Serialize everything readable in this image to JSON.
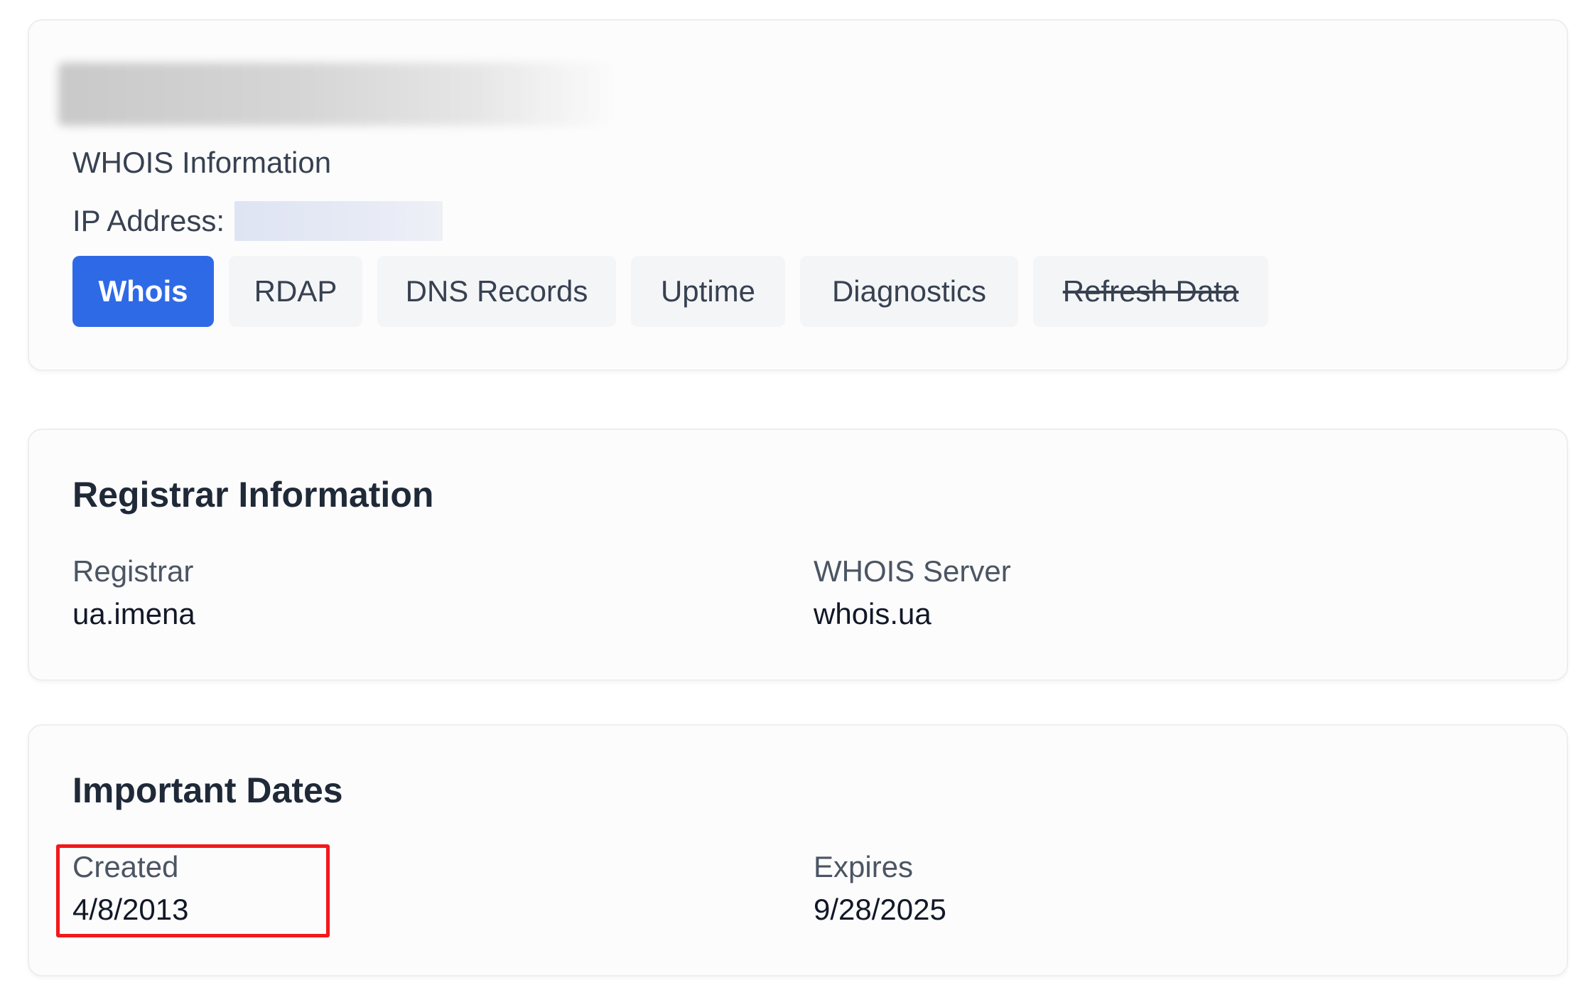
{
  "header": {
    "title_redacted": true,
    "subtitle": "WHOIS Information",
    "ip_label": "IP Address:",
    "ip_value_redacted": true
  },
  "tabs": [
    {
      "label": "Whois",
      "active": true,
      "struck": false
    },
    {
      "label": "RDAP",
      "active": false,
      "struck": false
    },
    {
      "label": "DNS Records",
      "active": false,
      "struck": false
    },
    {
      "label": "Uptime",
      "active": false,
      "struck": false
    },
    {
      "label": "Diagnostics",
      "active": false,
      "struck": false
    },
    {
      "label": "Refresh Data",
      "active": false,
      "struck": true
    }
  ],
  "registrar": {
    "title": "Registrar Information",
    "registrar_label": "Registrar",
    "registrar_value": "ua.imena",
    "server_label": "WHOIS Server",
    "server_value": "whois.ua"
  },
  "dates": {
    "title": "Important Dates",
    "created_label": "Created",
    "created_value": "4/8/2013",
    "expires_label": "Expires",
    "expires_value": "9/28/2025"
  },
  "colors": {
    "accent": "#2f6ae6",
    "highlight": "#f2181b",
    "tab_bg": "#f4f5f7"
  }
}
